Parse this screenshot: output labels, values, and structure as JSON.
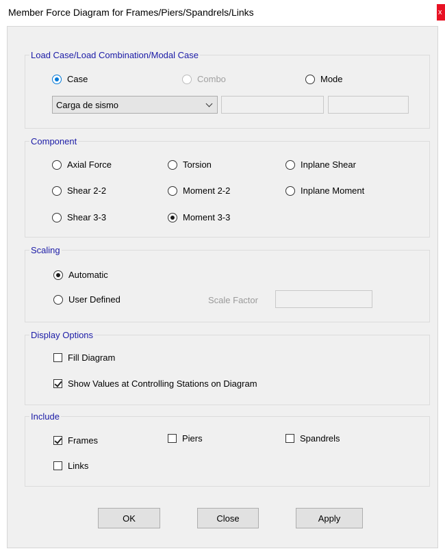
{
  "window": {
    "title": "Member Force Diagram for Frames/Piers/Spandrels/Links",
    "close_glyph": "x"
  },
  "load_case": {
    "legend": "Load Case/Load Combination/Modal Case",
    "options": {
      "case": "Case",
      "combo": "Combo",
      "mode": "Mode"
    },
    "selected": "Case",
    "case_dropdown_value": "Carga de sismo"
  },
  "component": {
    "legend": "Component",
    "options": {
      "axial": "Axial Force",
      "torsion": "Torsion",
      "inplane_shear": "Inplane Shear",
      "shear22": "Shear 2-2",
      "moment22": "Moment 2-2",
      "inplane_moment": "Inplane Moment",
      "shear33": "Shear 3-3",
      "moment33": "Moment 3-3"
    },
    "selected": "Moment 3-3"
  },
  "scaling": {
    "legend": "Scaling",
    "automatic": "Automatic",
    "user_defined": "User Defined",
    "selected": "Automatic",
    "scale_factor_label": "Scale Factor",
    "scale_factor_value": ""
  },
  "display_options": {
    "legend": "Display Options",
    "fill_diagram": {
      "label": "Fill Diagram",
      "checked": false
    },
    "show_values": {
      "label": "Show Values at Controlling Stations on Diagram",
      "checked": true
    }
  },
  "include": {
    "legend": "Include",
    "frames": {
      "label": "Frames",
      "checked": true
    },
    "piers": {
      "label": "Piers",
      "checked": false
    },
    "spandrels": {
      "label": "Spandrels",
      "checked": false
    },
    "links": {
      "label": "Links",
      "checked": false
    }
  },
  "buttons": {
    "ok": "OK",
    "close": "Close",
    "apply": "Apply"
  },
  "colors": {
    "legend_text": "#1a1aa6",
    "radio_selected_accent": "#0078d7",
    "close_button": "#e81123"
  }
}
